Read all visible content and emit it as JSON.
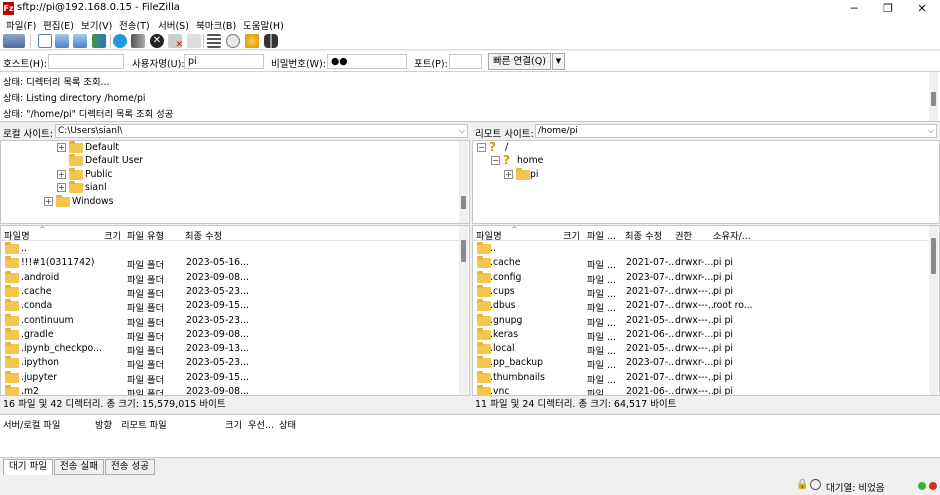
{
  "window": {
    "title": "sftp://pi@192.168.0.15 - FileZilla",
    "app_icon": "filezilla-icon",
    "minimize": "─",
    "maximize": "❐",
    "close": "✕"
  },
  "menu": [
    "파일(F)",
    "편집(E)",
    "보기(V)",
    "전송(T)",
    "서버(S)",
    "북마크(B)",
    "도움말(H)"
  ],
  "quickconnect": {
    "host_label": "호스트(H):",
    "host_value": "",
    "user_label": "사용자명(U):",
    "user_value": "pi",
    "pass_label": "비밀번호(W):",
    "pass_value": "●●",
    "port_label": "포트(P):",
    "port_value": "",
    "connect_button": "빠른 연결(Q)",
    "dropdown_icon": "▼"
  },
  "log": [
    "상태:  디렉터리 목록 조회...",
    "상태:  Listing directory /home/pi",
    "상태:  \"/home/pi\" 디렉터리 목록 조회 성공"
  ],
  "local": {
    "site_label": "로컬 사이트:",
    "site_path": "C:\\Users\\sianl\\",
    "tree": [
      {
        "label": "Default",
        "expander": "+"
      },
      {
        "label": "Default User",
        "expander": ""
      },
      {
        "label": "Public",
        "expander": "+"
      },
      {
        "label": "sianl",
        "expander": "+"
      },
      {
        "label": "Windows",
        "expander": "+"
      }
    ],
    "columns": [
      "파일명",
      "크기",
      "파일 유형",
      "최종 수정"
    ],
    "sort_indicator": "^",
    "rows": [
      {
        "name": "..",
        "size": "",
        "type": "",
        "modified": ""
      },
      {
        "name": "!!!#1(0311742)",
        "size": "",
        "type": "파일 폴더",
        "modified": "2023-05-16..."
      },
      {
        "name": ".android",
        "size": "",
        "type": "파일 폴더",
        "modified": "2023-09-08..."
      },
      {
        "name": ".cache",
        "size": "",
        "type": "파일 폴더",
        "modified": "2023-05-23..."
      },
      {
        "name": ".conda",
        "size": "",
        "type": "파일 폴더",
        "modified": "2023-09-15..."
      },
      {
        "name": ".continuum",
        "size": "",
        "type": "파일 폴더",
        "modified": "2023-05-23..."
      },
      {
        "name": ".gradle",
        "size": "",
        "type": "파일 폴더",
        "modified": "2023-09-08..."
      },
      {
        "name": ".ipynb_checkpo...",
        "size": "",
        "type": "파일 폴더",
        "modified": "2023-09-13..."
      },
      {
        "name": ".ipython",
        "size": "",
        "type": "파일 폴더",
        "modified": "2023-05-23..."
      },
      {
        "name": ".jupyter",
        "size": "",
        "type": "파일 폴더",
        "modified": "2023-09-15..."
      },
      {
        "name": ".m2",
        "size": "",
        "type": "파일 폴더",
        "modified": "2023-09-08..."
      }
    ],
    "status": "16 파일 및 42 디렉터리. 총 크기: 15,579,015 바이트"
  },
  "remote": {
    "site_label": "리모트 사이트:",
    "site_path": "/home/pi",
    "tree": [
      {
        "label": "/",
        "expander": "−",
        "indent": 0
      },
      {
        "label": "home",
        "expander": "−",
        "indent": 1
      },
      {
        "label": "pi",
        "expander": "+",
        "indent": 2
      }
    ],
    "columns": [
      "파일명",
      "크기",
      "파일 ...",
      "최종 수정",
      "권한",
      "소유자/..."
    ],
    "sort_indicator": "^",
    "rows": [
      {
        "name": "..",
        "size": "",
        "type": "",
        "modified": "",
        "perm": "",
        "owner": ""
      },
      {
        "name": ".cache",
        "size": "",
        "type": "파일 ...",
        "modified": "2021-07-...",
        "perm": "drwxr-...",
        "owner": "pi pi"
      },
      {
        "name": ".config",
        "size": "",
        "type": "파일 ...",
        "modified": "2023-07-...",
        "perm": "drwxr-...",
        "owner": "pi pi"
      },
      {
        "name": ".cups",
        "size": "",
        "type": "파일 ...",
        "modified": "2021-07-...",
        "perm": "drwx---...",
        "owner": "pi pi"
      },
      {
        "name": ".dbus",
        "size": "",
        "type": "파일 ...",
        "modified": "2021-07-...",
        "perm": "drwx---...",
        "owner": "root ro..."
      },
      {
        "name": ".gnupg",
        "size": "",
        "type": "파일 ...",
        "modified": "2021-05-...",
        "perm": "drwx---...",
        "owner": "pi pi"
      },
      {
        "name": ".keras",
        "size": "",
        "type": "파일 ...",
        "modified": "2021-06-...",
        "perm": "drwxr-...",
        "owner": "pi pi"
      },
      {
        "name": ".local",
        "size": "",
        "type": "파일 ...",
        "modified": "2021-05-...",
        "perm": "drwx---...",
        "owner": "pi pi"
      },
      {
        "name": ".pp_backup",
        "size": "",
        "type": "파일 ...",
        "modified": "2023-07-...",
        "perm": "drwxr-...",
        "owner": "pi pi"
      },
      {
        "name": ".thumbnails",
        "size": "",
        "type": "파일 ...",
        "modified": "2021-07-...",
        "perm": "drwx---...",
        "owner": "pi pi"
      },
      {
        "name": ".vnc",
        "size": "",
        "type": "파일 ...",
        "modified": "2021-06-...",
        "perm": "drwx---...",
        "owner": "pi pi"
      }
    ],
    "status": "11 파일 및 24 디렉터리. 총 크기: 64,517 바이트"
  },
  "queue": {
    "columns": [
      "서버/로컬 파일",
      "방향",
      "리모트 파일",
      "크기",
      "우선...",
      "상태"
    ]
  },
  "tabs": [
    "대기 파일",
    "전송 실패",
    "전송 성공"
  ],
  "bottom": {
    "queue_label": "대기열: 비었음",
    "lock_icon": "🔒"
  },
  "colors": {
    "folder": "#f3c74f",
    "led_green": "#3cb043",
    "led_red": "#d93025",
    "accent": "#0078d7"
  }
}
